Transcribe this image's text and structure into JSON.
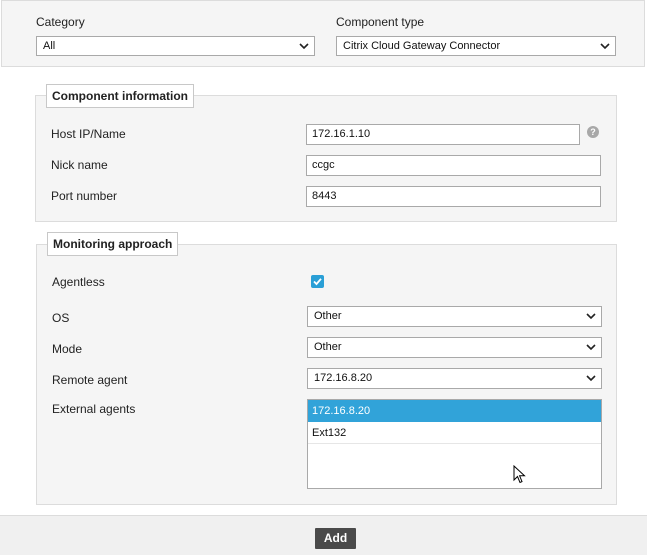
{
  "top": {
    "category_label": "Category",
    "category_value": "All",
    "component_type_label": "Component type",
    "component_type_value": "Citrix Cloud Gateway Connector"
  },
  "component_info": {
    "legend": "Component information",
    "host_label": "Host IP/Name",
    "host_value": "172.16.1.10",
    "host_help": "?",
    "nick_label": "Nick name",
    "nick_value": "ccgc",
    "port_label": "Port number",
    "port_value": "8443"
  },
  "monitoring": {
    "legend": "Monitoring approach",
    "agentless_label": "Agentless",
    "agentless_checked": true,
    "os_label": "OS",
    "os_value": "Other",
    "mode_label": "Mode",
    "mode_value": "Other",
    "remote_agent_label": "Remote agent",
    "remote_agent_value": "172.16.8.20",
    "external_agents_label": "External agents",
    "external_agents": [
      {
        "label": "172.16.8.20",
        "selected": true
      },
      {
        "label": "Ext132",
        "selected": false
      }
    ]
  },
  "footer": {
    "add_label": "Add"
  },
  "colors": {
    "accent": "#2a9fd6",
    "selected_row": "#31a3d9",
    "button": "#4a4a4a"
  }
}
